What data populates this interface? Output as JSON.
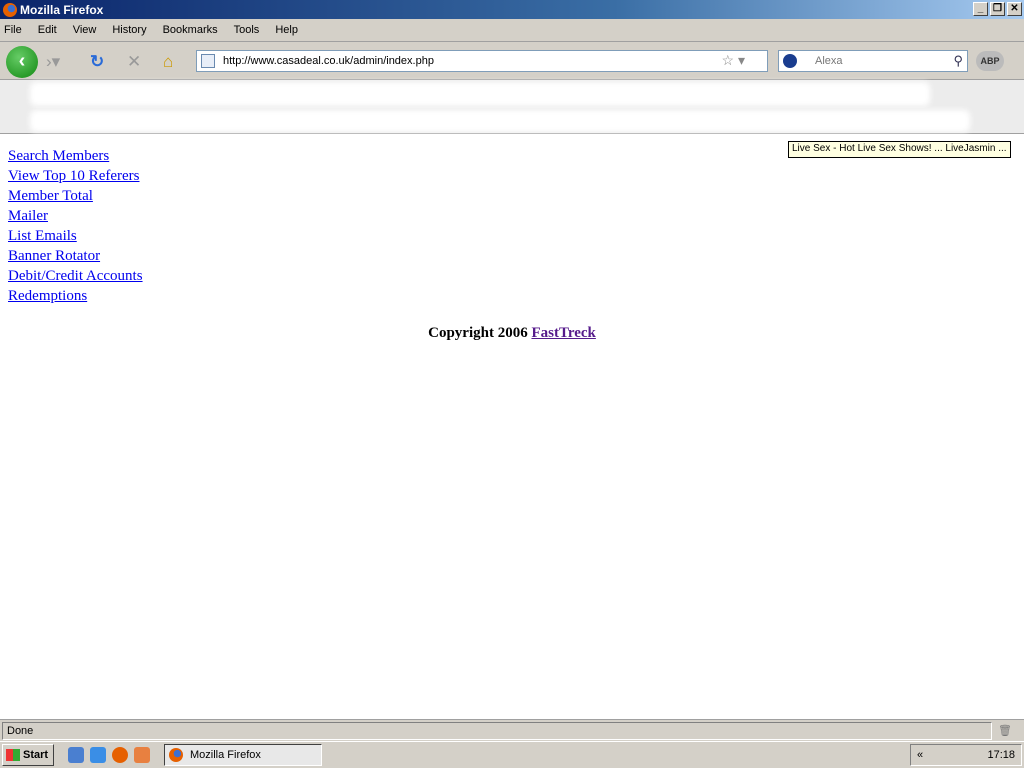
{
  "window": {
    "title": "Mozilla Firefox"
  },
  "menu": [
    "File",
    "Edit",
    "View",
    "History",
    "Bookmarks",
    "Tools",
    "Help"
  ],
  "nav": {
    "url": "http://www.casadeal.co.uk/admin/index.php",
    "search_placeholder": "Alexa",
    "abp_label": "ABP"
  },
  "tooltip": "Live Sex - Hot Live Sex Shows! ... LiveJasmin ...",
  "links": [
    "Search Members",
    "View Top 10 Referers",
    "Member Total",
    "Mailer",
    "List Emails",
    "Banner Rotator",
    "Debit/Credit Accounts",
    "Redemptions"
  ],
  "footer": {
    "copyright": "Copyright 2006",
    "link": "FastTreck"
  },
  "status": "Done",
  "taskbar": {
    "start": "Start",
    "task": "Mozilla Firefox",
    "clock": "17:18",
    "tray_expand": "«"
  },
  "colors": {
    "link": "#0000ee",
    "visited": "#551a8b"
  }
}
